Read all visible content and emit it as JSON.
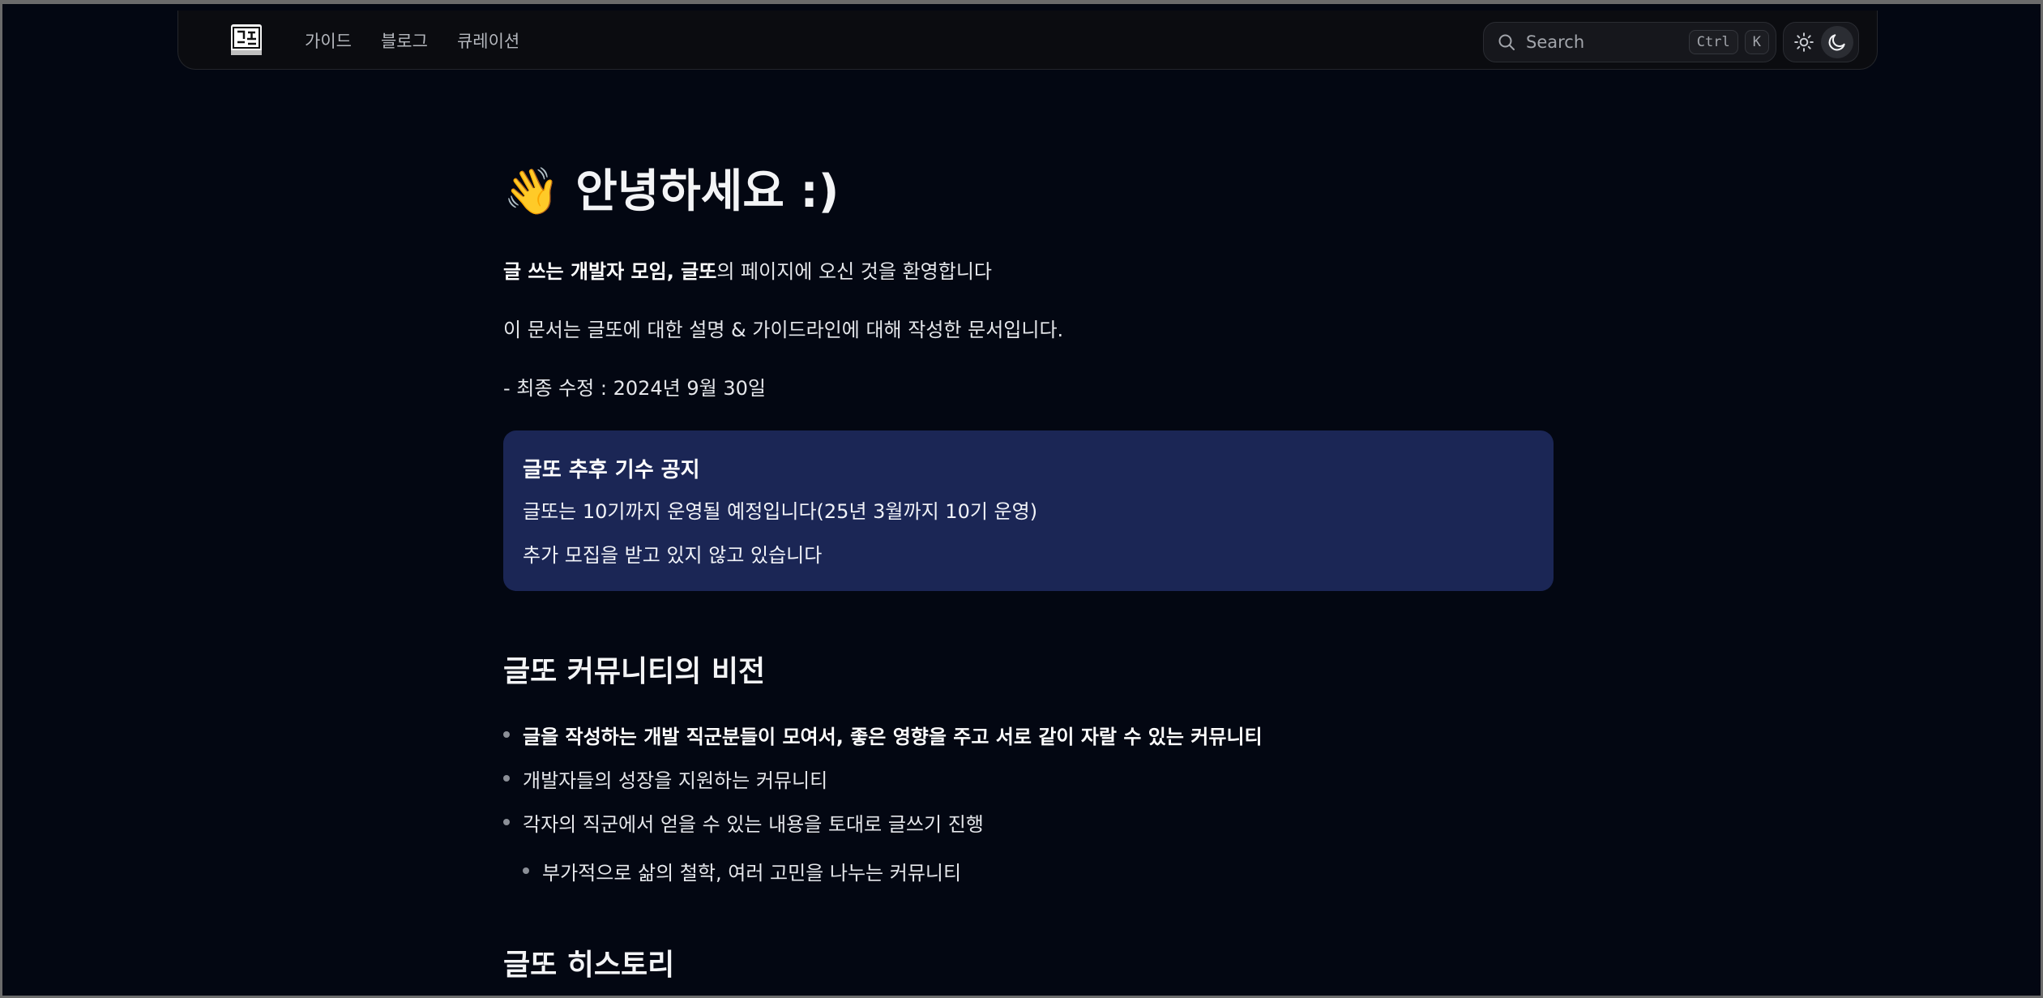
{
  "nav": {
    "links": [
      "가이드",
      "블로그",
      "큐레이션"
    ]
  },
  "search": {
    "placeholder": "Search",
    "shortcut_keys": [
      "Ctrl",
      "K"
    ]
  },
  "theme": {
    "icons": [
      "sun-icon",
      "moon-icon"
    ],
    "active": "dark"
  },
  "content": {
    "title_emoji": "👋",
    "title": "안녕하세요 :)",
    "intro_bold": "글 쓰는 개발자 모임, 글또",
    "intro_rest": "의 페이지에 오신 것을 환영합니다",
    "description": "이 문서는 글또에 대한 설명 & 가이드라인에 대해 작성한 문서입니다.",
    "last_modified": "- 최종 수정 : 2024년 9월 30일",
    "notice": {
      "title": "글또 추후 기수 공지",
      "lines": [
        "글또는 10기까지 운영될 예정입니다(25년 3월까지 10기 운영)",
        "추가 모집을 받고 있지 않고 있습니다"
      ]
    },
    "vision_heading": "글또 커뮤니티의 비전",
    "vision_items": [
      "글을 작성하는 개발 직군분들이 모여서, 좋은 영향을 주고 서로 같이 자랄 수 있는 커뮤니티",
      "개발자들의 성장을 지원하는 커뮤니티",
      "각자의 직군에서 얻을 수 있는 내용을 토대로 글쓰기 진행"
    ],
    "vision_subitem": "부가적으로 삶의 철학, 여러 고민을 나누는 커뮤니티",
    "history_heading": "글또 히스토리"
  },
  "colors": {
    "background": "#030712",
    "notice_background": "#1b2655",
    "text": "#e5e7eb"
  }
}
